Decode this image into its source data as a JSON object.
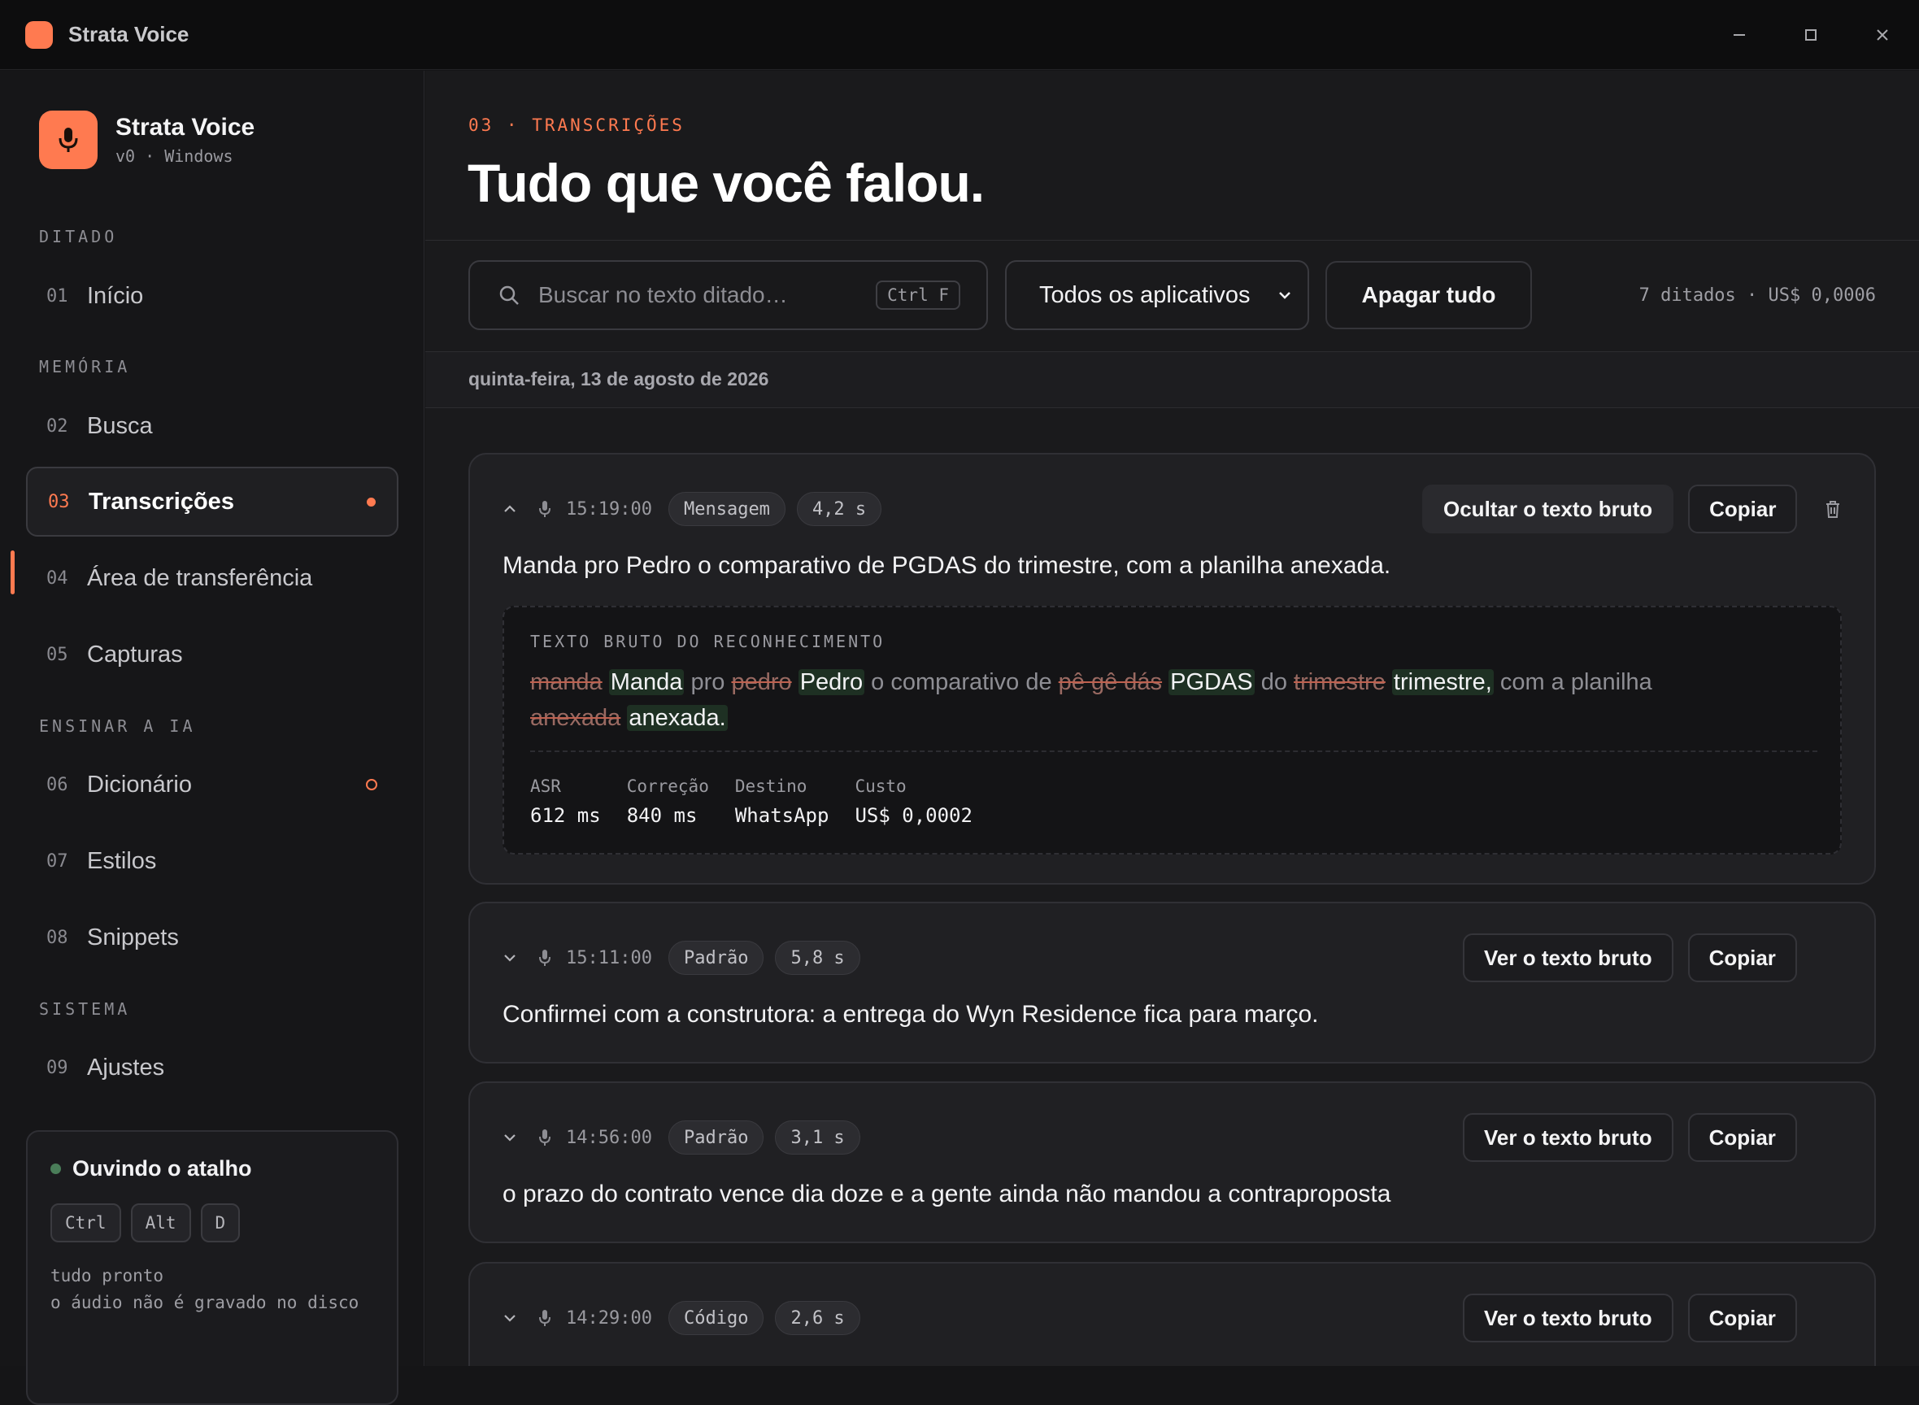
{
  "window": {
    "title": "Strata Voice"
  },
  "sidebar": {
    "brand": {
      "name": "Strata Voice",
      "version": "v0 · Windows"
    },
    "sections": {
      "dictation": "DITADO",
      "memory": "MEMÓRIA",
      "teach": "ENSINAR A IA",
      "system": "SISTEMA"
    },
    "items": [
      {
        "num": "01",
        "label": "Início"
      },
      {
        "num": "02",
        "label": "Busca"
      },
      {
        "num": "03",
        "label": "Transcrições"
      },
      {
        "num": "04",
        "label": "Área de transferência"
      },
      {
        "num": "05",
        "label": "Capturas"
      },
      {
        "num": "06",
        "label": "Dicionário"
      },
      {
        "num": "07",
        "label": "Estilos"
      },
      {
        "num": "08",
        "label": "Snippets"
      },
      {
        "num": "09",
        "label": "Ajustes"
      }
    ],
    "status": {
      "title": "Ouvindo o atalho",
      "keys": [
        "Ctrl",
        "Alt",
        "D"
      ],
      "line1": "tudo pronto",
      "line2": "o áudio não é gravado no disco"
    }
  },
  "main": {
    "kicker": "03 · TRANSCRIÇÕES",
    "title": "Tudo que você falou.",
    "search": {
      "placeholder": "Buscar no texto ditado…",
      "shortcut": "Ctrl F"
    },
    "filter": {
      "selected": "Todos os aplicativos"
    },
    "clear_label": "Apagar tudo",
    "summary": "7 ditados · US$ 0,0006",
    "date": "quinta-feira, 13 de agosto de 2026",
    "entries": [
      {
        "time": "15:19:00",
        "style": "Mensagem",
        "duration": "4,2 s",
        "toggle_label": "Ocultar o texto bruto",
        "copy_label": "Copiar",
        "text": "Manda pro Pedro o comparativo de PGDAS do trimestre, com a planilha anexada.",
        "raw": {
          "label": "TEXTO BRUTO DO RECONHECIMENTO",
          "tokens": [
            {
              "t": "manda",
              "k": "del"
            },
            {
              "t": "Manda",
              "k": "ins"
            },
            {
              "t": "pro",
              "k": ""
            },
            {
              "t": "pedro",
              "k": "del"
            },
            {
              "t": "Pedro",
              "k": "ins"
            },
            {
              "t": "o comparativo de",
              "k": ""
            },
            {
              "t": "pê gê dás",
              "k": "del"
            },
            {
              "t": "PGDAS",
              "k": "ins"
            },
            {
              "t": "do",
              "k": ""
            },
            {
              "t": "trimestre",
              "k": "del"
            },
            {
              "t": "trimestre,",
              "k": "ins"
            },
            {
              "t": "com a planilha",
              "k": ""
            },
            {
              "t": "anexada",
              "k": "del"
            },
            {
              "t": "anexada.",
              "k": "ins"
            }
          ],
          "stats": [
            {
              "k": "ASR",
              "v": "612 ms"
            },
            {
              "k": "Correção",
              "v": "840 ms"
            },
            {
              "k": "Destino",
              "v": "WhatsApp"
            },
            {
              "k": "Custo",
              "v": "US$ 0,0002"
            }
          ]
        }
      },
      {
        "time": "15:11:00",
        "style": "Padrão",
        "duration": "5,8 s",
        "toggle_label": "Ver o texto bruto",
        "copy_label": "Copiar",
        "text": "Confirmei com a construtora: a entrega do Wyn Residence fica para março."
      },
      {
        "time": "14:56:00",
        "style": "Padrão",
        "duration": "3,1 s",
        "toggle_label": "Ver o texto bruto",
        "copy_label": "Copiar",
        "text": "o prazo do contrato vence dia doze e a gente ainda não mandou a contraproposta"
      },
      {
        "time": "14:29:00",
        "style": "Código",
        "duration": "2,6 s",
        "toggle_label": "Ver o texto bruto",
        "copy_label": "Copiar",
        "text": ""
      }
    ]
  },
  "colors": {
    "accent": "#ff7a50",
    "background": "#1a1a1c",
    "ok": "#4a7d59"
  }
}
